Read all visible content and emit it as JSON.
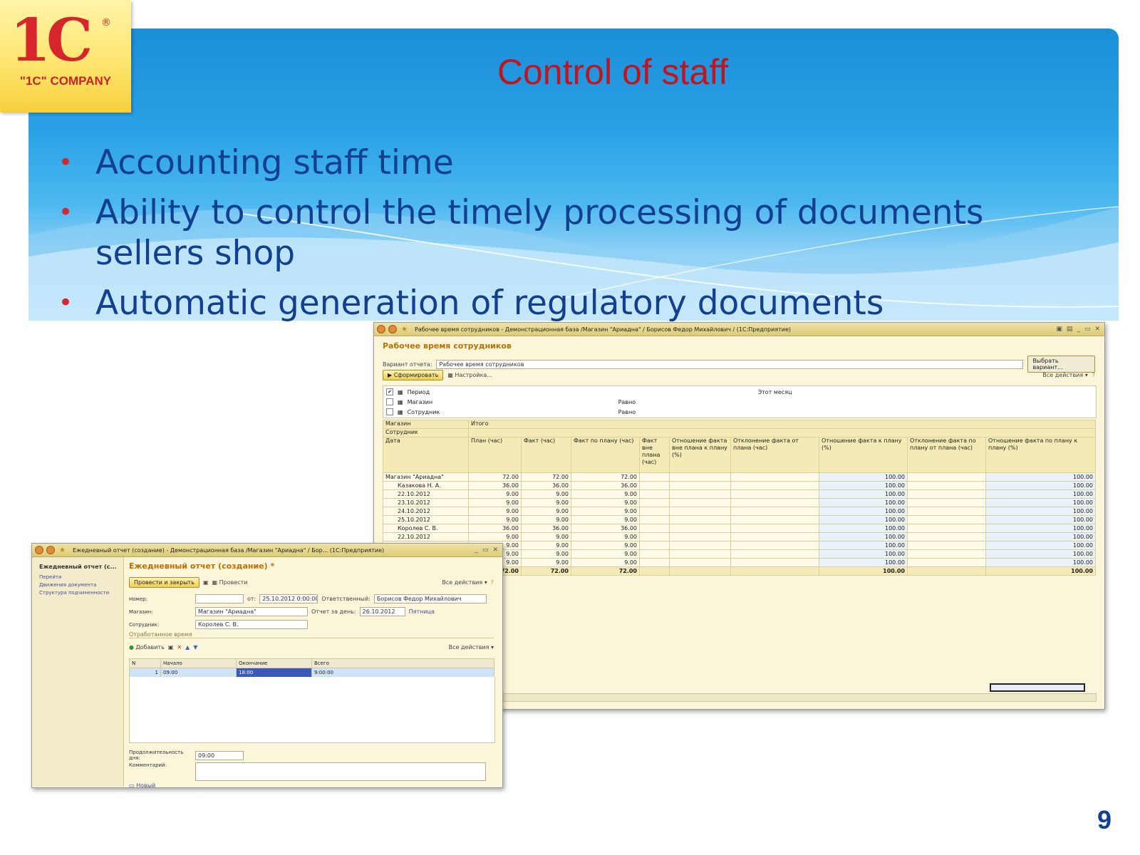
{
  "slide": {
    "logo_text": "\"1C\" COMPANY",
    "logo_mark": "1C",
    "logo_reg": "®",
    "title": "Control of staff",
    "bullets": [
      "Accounting staff time",
      "Ability to control the timely processing of documents sellers shop",
      "Automatic generation of regulatory documents"
    ],
    "page_number": "9"
  },
  "report_window": {
    "title_text": "Рабочее время сотрудников - Демонстрационная база /Магазин \"Ариадна\" / Борисов Федор Михайлович / (1С:Предприятие)",
    "heading": "Рабочее время сотрудников",
    "variant_label": "Вариант отчета:",
    "variant_value": "Рабочее время сотрудников",
    "choose_variant_button": "Выбрать вариант...",
    "generate_button": "Сформировать",
    "settings_button": "Настройка...",
    "all_actions": "Все действия ▾",
    "filters": [
      {
        "checked": "✔",
        "name": "Период",
        "condition": "",
        "value": "Этот месяц"
      },
      {
        "checked": "",
        "name": "Магазин",
        "condition": "Равно",
        "value": ""
      },
      {
        "checked": "",
        "name": "Сотрудник",
        "condition": "Равно",
        "value": ""
      }
    ],
    "group_header_1": "Магазин",
    "group_header_2": "Сотрудник",
    "total_header": "Итого",
    "columns": [
      "Дата",
      "План (час)",
      "Факт (час)",
      "Факт по плану (час)",
      "Факт вне плана (час)",
      "Отношение факта вне плана к плану (%)",
      "Отклонение факта от плана (час)",
      "Отношение факта к плану (%)",
      "Отклонение факта по плану от плана (час)",
      "Отношение факта по плану к плану (%)"
    ],
    "rows": [
      {
        "label": "Магазин \"Ариадна\"",
        "plan": "72.00",
        "fact": "72.00",
        "fact_plan": "72.00",
        "ratio": "100.00",
        "ratio2": "100.00"
      },
      {
        "label": "Казакова Н. А.",
        "plan": "36.00",
        "fact": "36.00",
        "fact_plan": "36.00",
        "ratio": "100.00",
        "ratio2": "100.00"
      },
      {
        "label": "22.10.2012",
        "plan": "9.00",
        "fact": "9.00",
        "fact_plan": "9.00",
        "ratio": "100.00",
        "ratio2": "100.00"
      },
      {
        "label": "23.10.2012",
        "plan": "9.00",
        "fact": "9.00",
        "fact_plan": "9.00",
        "ratio": "100.00",
        "ratio2": "100.00"
      },
      {
        "label": "24.10.2012",
        "plan": "9.00",
        "fact": "9.00",
        "fact_plan": "9.00",
        "ratio": "100.00",
        "ratio2": "100.00"
      },
      {
        "label": "25.10.2012",
        "plan": "9.00",
        "fact": "9.00",
        "fact_plan": "9.00",
        "ratio": "100.00",
        "ratio2": "100.00"
      },
      {
        "label": "Королев С. В.",
        "plan": "36.00",
        "fact": "36.00",
        "fact_plan": "36.00",
        "ratio": "100.00",
        "ratio2": "100.00"
      },
      {
        "label": "22.10.2012",
        "plan": "9.00",
        "fact": "9.00",
        "fact_plan": "9.00",
        "ratio": "100.00",
        "ratio2": "100.00"
      },
      {
        "label": "23.10.2012",
        "plan": "9.00",
        "fact": "9.00",
        "fact_plan": "9.00",
        "ratio": "100.00",
        "ratio2": "100.00"
      },
      {
        "label": "",
        "plan": "9.00",
        "fact": "9.00",
        "fact_plan": "9.00",
        "ratio": "100.00",
        "ratio2": "100.00"
      },
      {
        "label": "",
        "plan": "9.00",
        "fact": "9.00",
        "fact_plan": "9.00",
        "ratio": "100.00",
        "ratio2": "100.00"
      }
    ],
    "total_row": {
      "plan": "72.00",
      "fact": "72.00",
      "fact_plan": "72.00",
      "ratio": "100.00",
      "ratio2": "100.00"
    }
  },
  "daily_window": {
    "title_text": "Ежедневный отчет (создание) - Демонстрационная база /Магазин \"Ариадна\" / Бор... (1С:Предприятие)",
    "side_title": "Ежедневный отчет (с...",
    "side_items": [
      "Перейти",
      "Движения документа",
      "Структура подчиненности"
    ],
    "heading": "Ежедневный отчет (создание) *",
    "post_close_button": "Провести и закрыть",
    "post_button": "Провести",
    "all_actions": "Все действия ▾",
    "number_label": "Номер:",
    "number_value": "",
    "date_from_label": "от:",
    "date_from_value": "25.10.2012 0:00:00",
    "responsible_label": "Ответственный:",
    "responsible_value": "Борисов Федор Михайлович",
    "shop_label": "Магазин:",
    "shop_value": "Магазин \"Ариадна\"",
    "report_day_label": "Отчет за день:",
    "report_day_value": "26.10.2012",
    "weekday": "Пятница",
    "employee_label": "Сотрудник:",
    "employee_value": "Королев С. В.",
    "worked_time_label": "Отработанное время",
    "add_button": "Добавить",
    "table_headers": [
      "N",
      "Начало",
      "Окончание",
      "Всего"
    ],
    "table_row": {
      "n": "1",
      "start": "09:00",
      "end": "18:00",
      "total": "9:00:00"
    },
    "duration_label": "Продолжительность дня:",
    "duration_value": "09:00",
    "comment_label": "Комментарий:",
    "comment_value": "",
    "new_label": "Новый"
  },
  "colors": {
    "title_red": "#c0151e",
    "bullet_blue": "#123f8f",
    "banner_blue": "#1b8ed8",
    "heading_orange": "#c06e00"
  }
}
